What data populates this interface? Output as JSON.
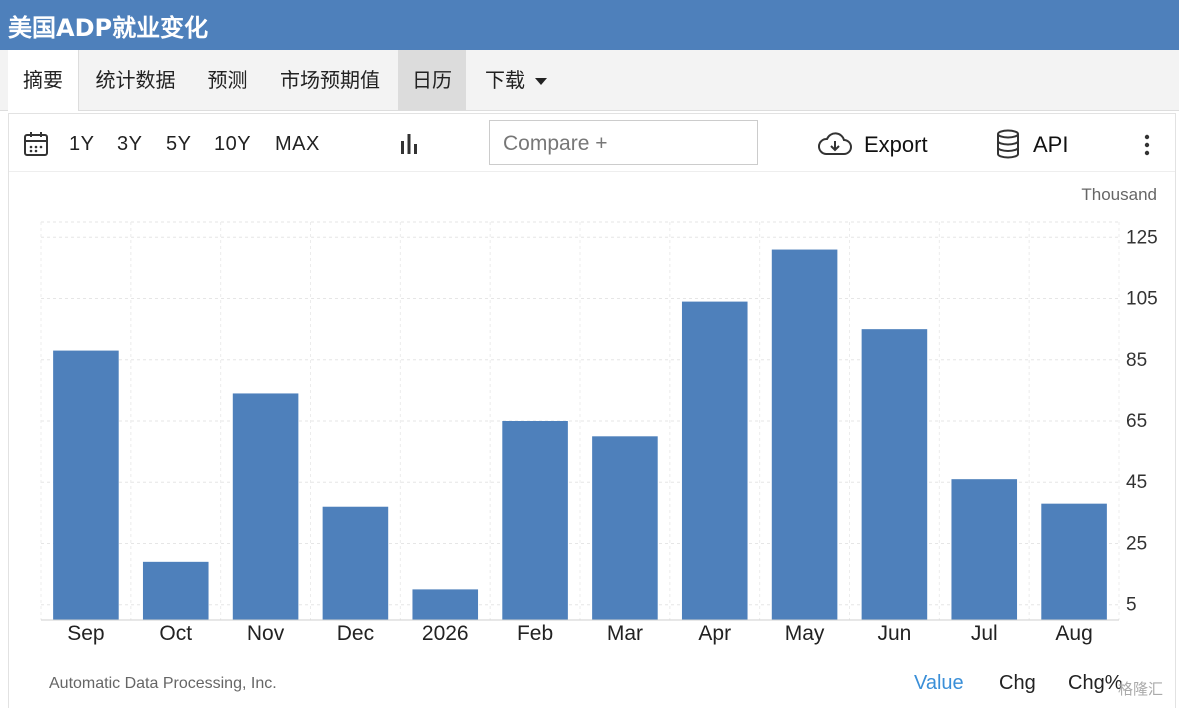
{
  "header": {
    "title": "美国ADP就业变化"
  },
  "nav": {
    "tabs": [
      {
        "label": "摘要"
      },
      {
        "label": "统计数据"
      },
      {
        "label": "预测"
      },
      {
        "label": "市场预期值"
      },
      {
        "label": "日历"
      },
      {
        "label": "下载"
      }
    ]
  },
  "toolbar": {
    "ranges": [
      "1Y",
      "3Y",
      "5Y",
      "10Y",
      "MAX"
    ],
    "compare_placeholder": "Compare +",
    "export_label": "Export",
    "api_label": "API"
  },
  "chart_data": {
    "type": "bar",
    "ylabel": "Thousand",
    "categories": [
      "Sep",
      "Oct",
      "Nov",
      "Dec",
      "2026",
      "Feb",
      "Mar",
      "Apr",
      "May",
      "Jun",
      "Jul",
      "Aug"
    ],
    "values": [
      88,
      19,
      74,
      37,
      10,
      65,
      60,
      104,
      121,
      95,
      46,
      38
    ],
    "yticks": [
      5,
      25,
      45,
      65,
      85,
      105,
      125
    ],
    "ylim": [
      0,
      130
    ],
    "y_axis_side": "right",
    "grid": true,
    "bar_color": "#4e80bb"
  },
  "footer": {
    "source": "Automatic Data Processing, Inc.",
    "tabs": [
      {
        "label": "Value",
        "active": true
      },
      {
        "label": "Chg",
        "active": false
      },
      {
        "label": "Chg%",
        "active": false
      }
    ],
    "watermark": "格隆汇"
  },
  "colors": {
    "brand": "#4e80bb",
    "active_tab": "#3a8fd8"
  }
}
